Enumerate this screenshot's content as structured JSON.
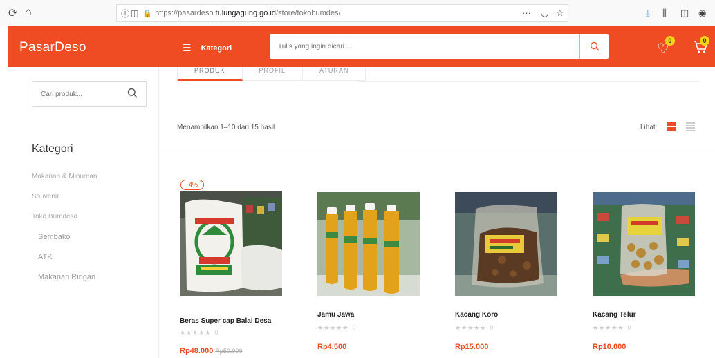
{
  "browser": {
    "url_info_icon": "ⓘ",
    "url_prefix": "https://pasardeso.",
    "url_host": "tulungagung.go.id",
    "url_path": "/store/tokobumdes/",
    "menu_dots": "···"
  },
  "header": {
    "logo": "PasarDeso",
    "kategori_label": "Kategori",
    "search_placeholder": "Tulis yang ingin dicari ...",
    "wishlist_count": "0",
    "cart_count": "0",
    "accent_color": "#ef4c23"
  },
  "sidebar": {
    "search_placeholder": "Cari produk...",
    "title": "Kategori",
    "items": [
      {
        "label": "Makanan & Minuman"
      },
      {
        "label": "Souvenir"
      },
      {
        "label": "Toko Bumdesa"
      },
      {
        "label": "Sembako"
      },
      {
        "label": "ATK"
      },
      {
        "label": "Makanan Ringan"
      }
    ]
  },
  "tabs": [
    {
      "label": "PRODUK"
    },
    {
      "label": "PROFIL"
    },
    {
      "label": "ATURAN"
    }
  ],
  "listing": {
    "result_count": "Menampilkan 1–10 dari 15 hasil",
    "view_label": "Lihat:",
    "discount_badge": "-4%"
  },
  "products": [
    {
      "name": "Beras Super cap Balai Desa",
      "rating": "★★★★★",
      "rating_count": "0",
      "price": "Rp48.000",
      "old_price": "Rp50.000"
    },
    {
      "name": "Jamu Jawa",
      "rating": "★★★★★",
      "rating_count": "0",
      "price": "Rp4.500",
      "old_price": ""
    },
    {
      "name": "Kacang Koro",
      "rating": "★★★★★",
      "rating_count": "0",
      "price": "Rp15.000",
      "old_price": ""
    },
    {
      "name": "Kacang Telur",
      "rating": "★★★★★",
      "rating_count": "0",
      "price": "Rp10.000",
      "old_price": ""
    }
  ]
}
